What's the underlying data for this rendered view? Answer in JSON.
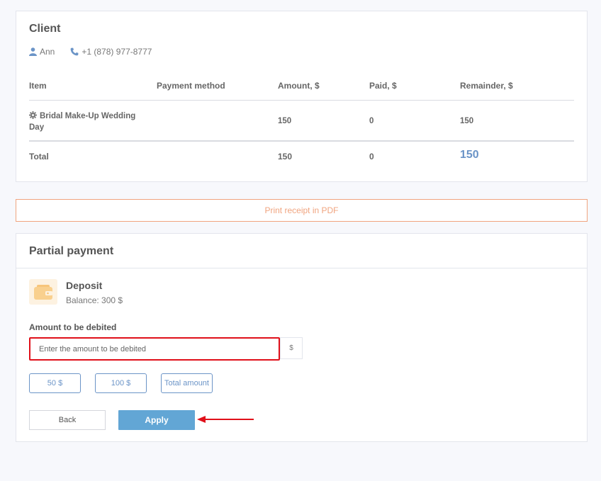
{
  "client": {
    "title": "Client",
    "name": "Ann",
    "phone": "+1 (878) 977-8777"
  },
  "table": {
    "headers": {
      "item": "Item",
      "method": "Payment method",
      "amount": "Amount, $",
      "paid": "Paid, $",
      "remainder": "Remainder, $"
    },
    "rows": [
      {
        "item": "Bridal Make-Up Wedding Day",
        "method": "",
        "amount": "150",
        "paid": "0",
        "remainder": "150"
      }
    ],
    "total": {
      "label": "Total",
      "amount": "150",
      "paid": "0",
      "remainder": "150"
    }
  },
  "print_receipt": "Print receipt in PDF",
  "partial": {
    "title": "Partial payment",
    "deposit_title": "Deposit",
    "deposit_balance": "Balance: 300 $",
    "amount_label": "Amount to be debited",
    "amount_placeholder": "Enter the amount to be debited",
    "currency": "$",
    "chips": [
      "50 $",
      "100 $",
      "Total amount"
    ],
    "back_label": "Back",
    "apply_label": "Apply"
  },
  "colors": {
    "accent_blue": "#62a6d5",
    "link_blue": "#6b94c7",
    "print_orange": "#f0a47f",
    "highlight_red": "#e0101a"
  },
  "icons": [
    "user-icon",
    "phone-icon",
    "gear-icon",
    "wallet-icon",
    "arrow-left-icon"
  ]
}
